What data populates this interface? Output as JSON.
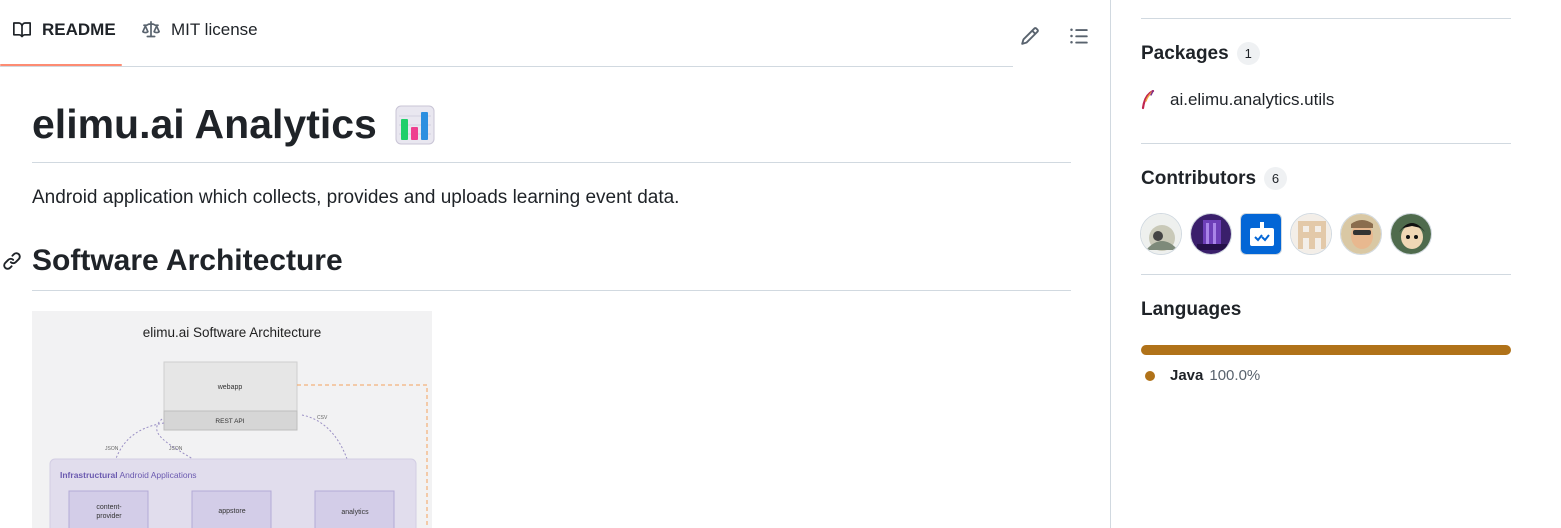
{
  "tabs": {
    "readme_label": "README",
    "license_label": "MIT license"
  },
  "readme": {
    "title": "elimu.ai Analytics",
    "title_emoji": "bar-chart-emoji",
    "description": "Android application which collects, provides and uploads learning event data.",
    "section_heading": "Software Architecture",
    "diagram": {
      "title": "elimu.ai Software Architecture",
      "webapp": "webapp",
      "rest_api": "REST API",
      "json_left": "JSON",
      "json_right": "JSON",
      "csv": "CSV",
      "group_label_bold": "Infrastructural",
      "group_label_rest": " Android Applications",
      "app1_line1": "content-",
      "app1_line2": "provider",
      "app2": "appstore",
      "app3": "analytics"
    }
  },
  "sidebar": {
    "packages": {
      "heading": "Packages",
      "count": "1",
      "items": [
        {
          "name": "ai.elimu.analytics.utils",
          "icon": "feather-icon"
        }
      ]
    },
    "contributors": {
      "heading": "Contributors",
      "count": "6"
    },
    "languages": {
      "heading": "Languages",
      "items": [
        {
          "name": "Java",
          "percent": "100.0%",
          "fraction": 1.0,
          "color": "#b07219"
        }
      ]
    }
  },
  "colors": {
    "tab_underline": "#fd8c73",
    "java": "#b07219",
    "border": "#d1d9e0"
  }
}
